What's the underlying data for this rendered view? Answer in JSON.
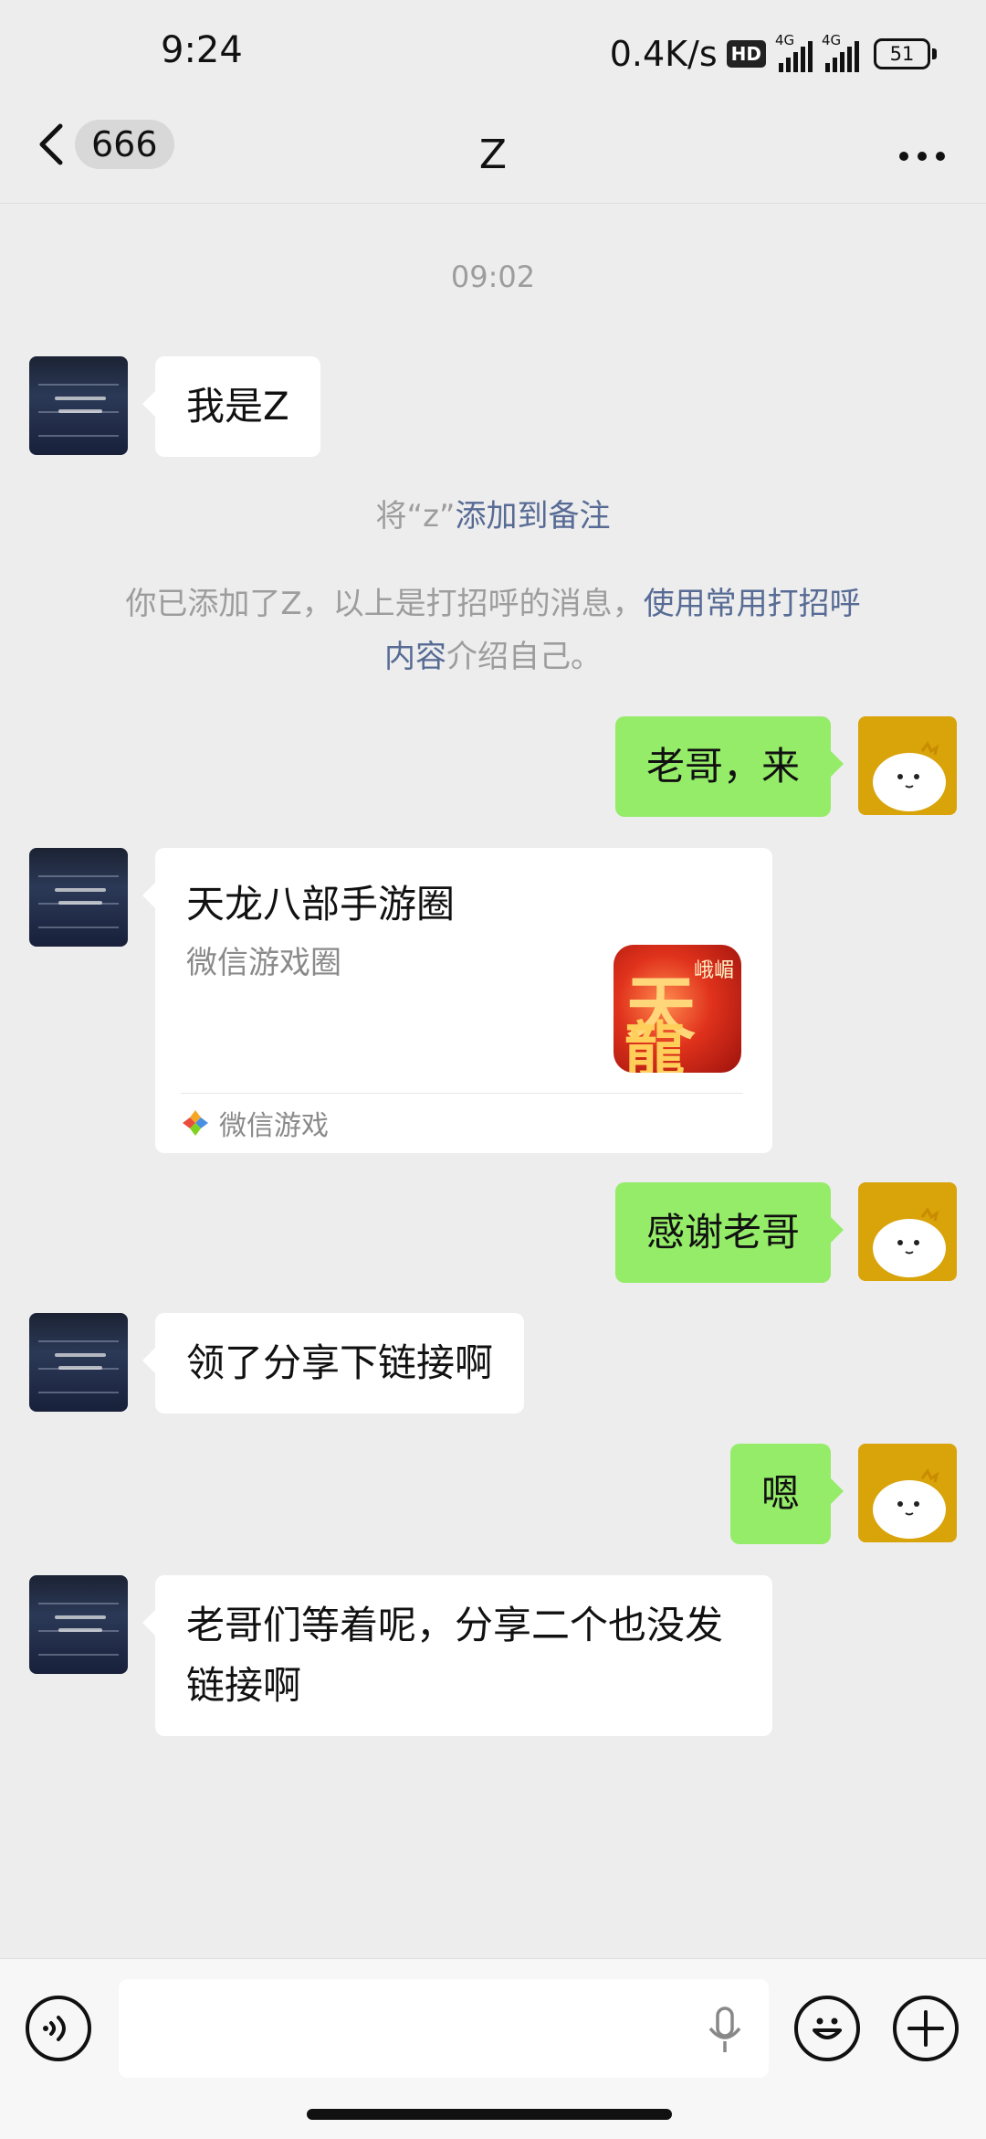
{
  "status_bar": {
    "time": "9:24",
    "net_speed": "0.4K/s",
    "hd_badge": "HD",
    "network_label_1": "4G",
    "network_label_2": "4G",
    "battery": "51"
  },
  "header": {
    "back_icon": "chevron-left-icon",
    "unread_count": "666",
    "title": "Z",
    "more_icon": "more-dots-icon"
  },
  "timestamp": "09:02",
  "messages": [
    {
      "side": "in",
      "type": "text",
      "text": "我是Z"
    },
    {
      "side": "out",
      "type": "text",
      "text": "老哥，来"
    },
    {
      "side": "in",
      "type": "card",
      "card_title": "天龙八部手游圈",
      "card_desc": "微信游戏圈",
      "card_source": "微信游戏",
      "thumb_glyph_1": "天",
      "thumb_glyph_2": "龍",
      "thumb_corner": "峨嵋"
    },
    {
      "side": "out",
      "type": "text",
      "text": "感谢老哥"
    },
    {
      "side": "in",
      "type": "text",
      "text": "领了分享下链接啊"
    },
    {
      "side": "out",
      "type": "text",
      "text": "嗯"
    },
    {
      "side": "in",
      "type": "text",
      "text": "老哥们等着呢，分享二个也没发链接啊"
    }
  ],
  "system": {
    "remark_prefix": "将“z”",
    "remark_link": "添加到备注",
    "greeting_prefix": "你已添加了Z，以上是打招呼的消息，",
    "greeting_link_1": "使用常用打招呼",
    "greeting_link_2": "内容",
    "greeting_suffix": "介绍自己。"
  },
  "input_bar": {
    "voice_icon": "voice-icon",
    "placeholder": "",
    "mic_icon": "mic-icon",
    "emoji_icon": "emoji-icon",
    "plus_icon": "plus-icon"
  },
  "colors": {
    "background": "#ededed",
    "bubble_out": "#95ec69",
    "bubble_in": "#ffffff",
    "link": "#576b95"
  }
}
